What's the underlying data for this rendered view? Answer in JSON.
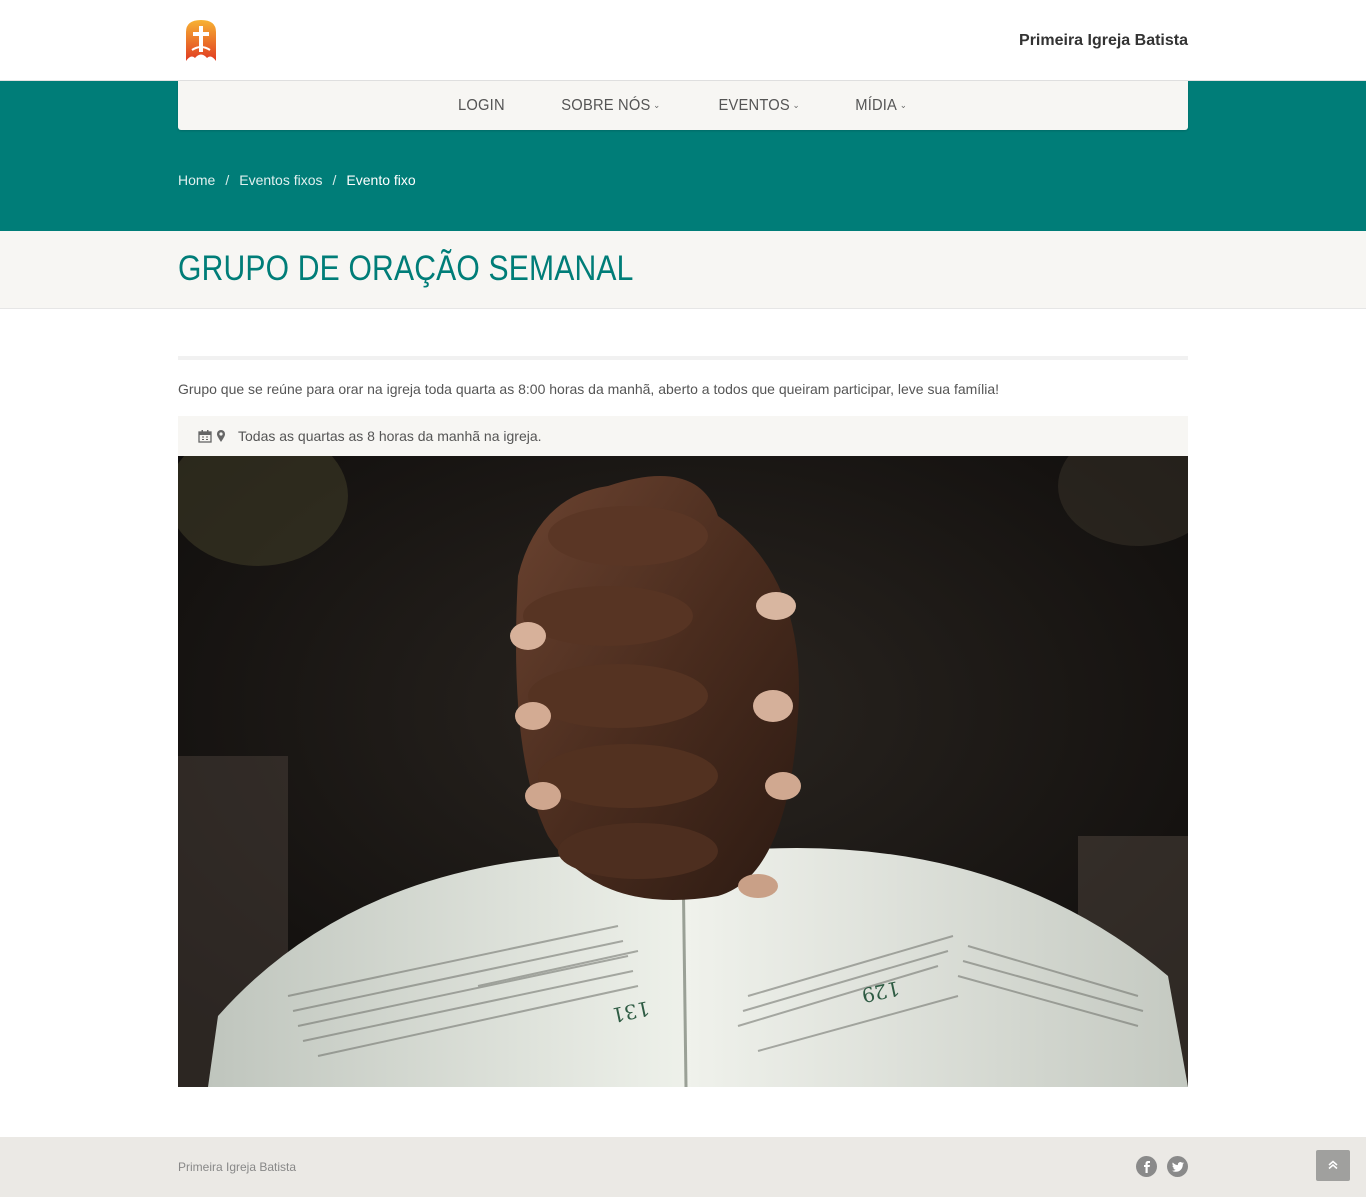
{
  "header": {
    "site_name": "Primeira Igreja Batista",
    "logo_icon": "cross-flame-logo",
    "accent_color": "#007d78"
  },
  "nav": {
    "items": [
      {
        "label": "LOGIN",
        "dropdown": false
      },
      {
        "label": "SOBRE NÓS",
        "dropdown": true
      },
      {
        "label": "EVENTOS",
        "dropdown": true
      },
      {
        "label": "MÍDIA",
        "dropdown": true
      }
    ]
  },
  "breadcrumb": {
    "items": [
      "Home",
      "Eventos fixos"
    ],
    "current": "Evento fixo",
    "separator": "/"
  },
  "event": {
    "title": "GRUPO DE ORAÇÃO SEMANAL",
    "description": "Grupo que se reúne para orar na igreja toda quarta as 8:00 horas da manhã, aberto a todos que queiram participar, leve sua família!",
    "schedule": "Todas as quartas as 8 horas da manhã na igreja.",
    "schedule_icons": [
      "calendar-icon",
      "map-marker-icon"
    ],
    "image": "praying-hands-over-bible-photo"
  },
  "footer": {
    "text": "Primeira Igreja Batista",
    "social": [
      "facebook-icon",
      "twitter-icon"
    ],
    "back_to_top_icon": "double-chevron-up-icon"
  }
}
